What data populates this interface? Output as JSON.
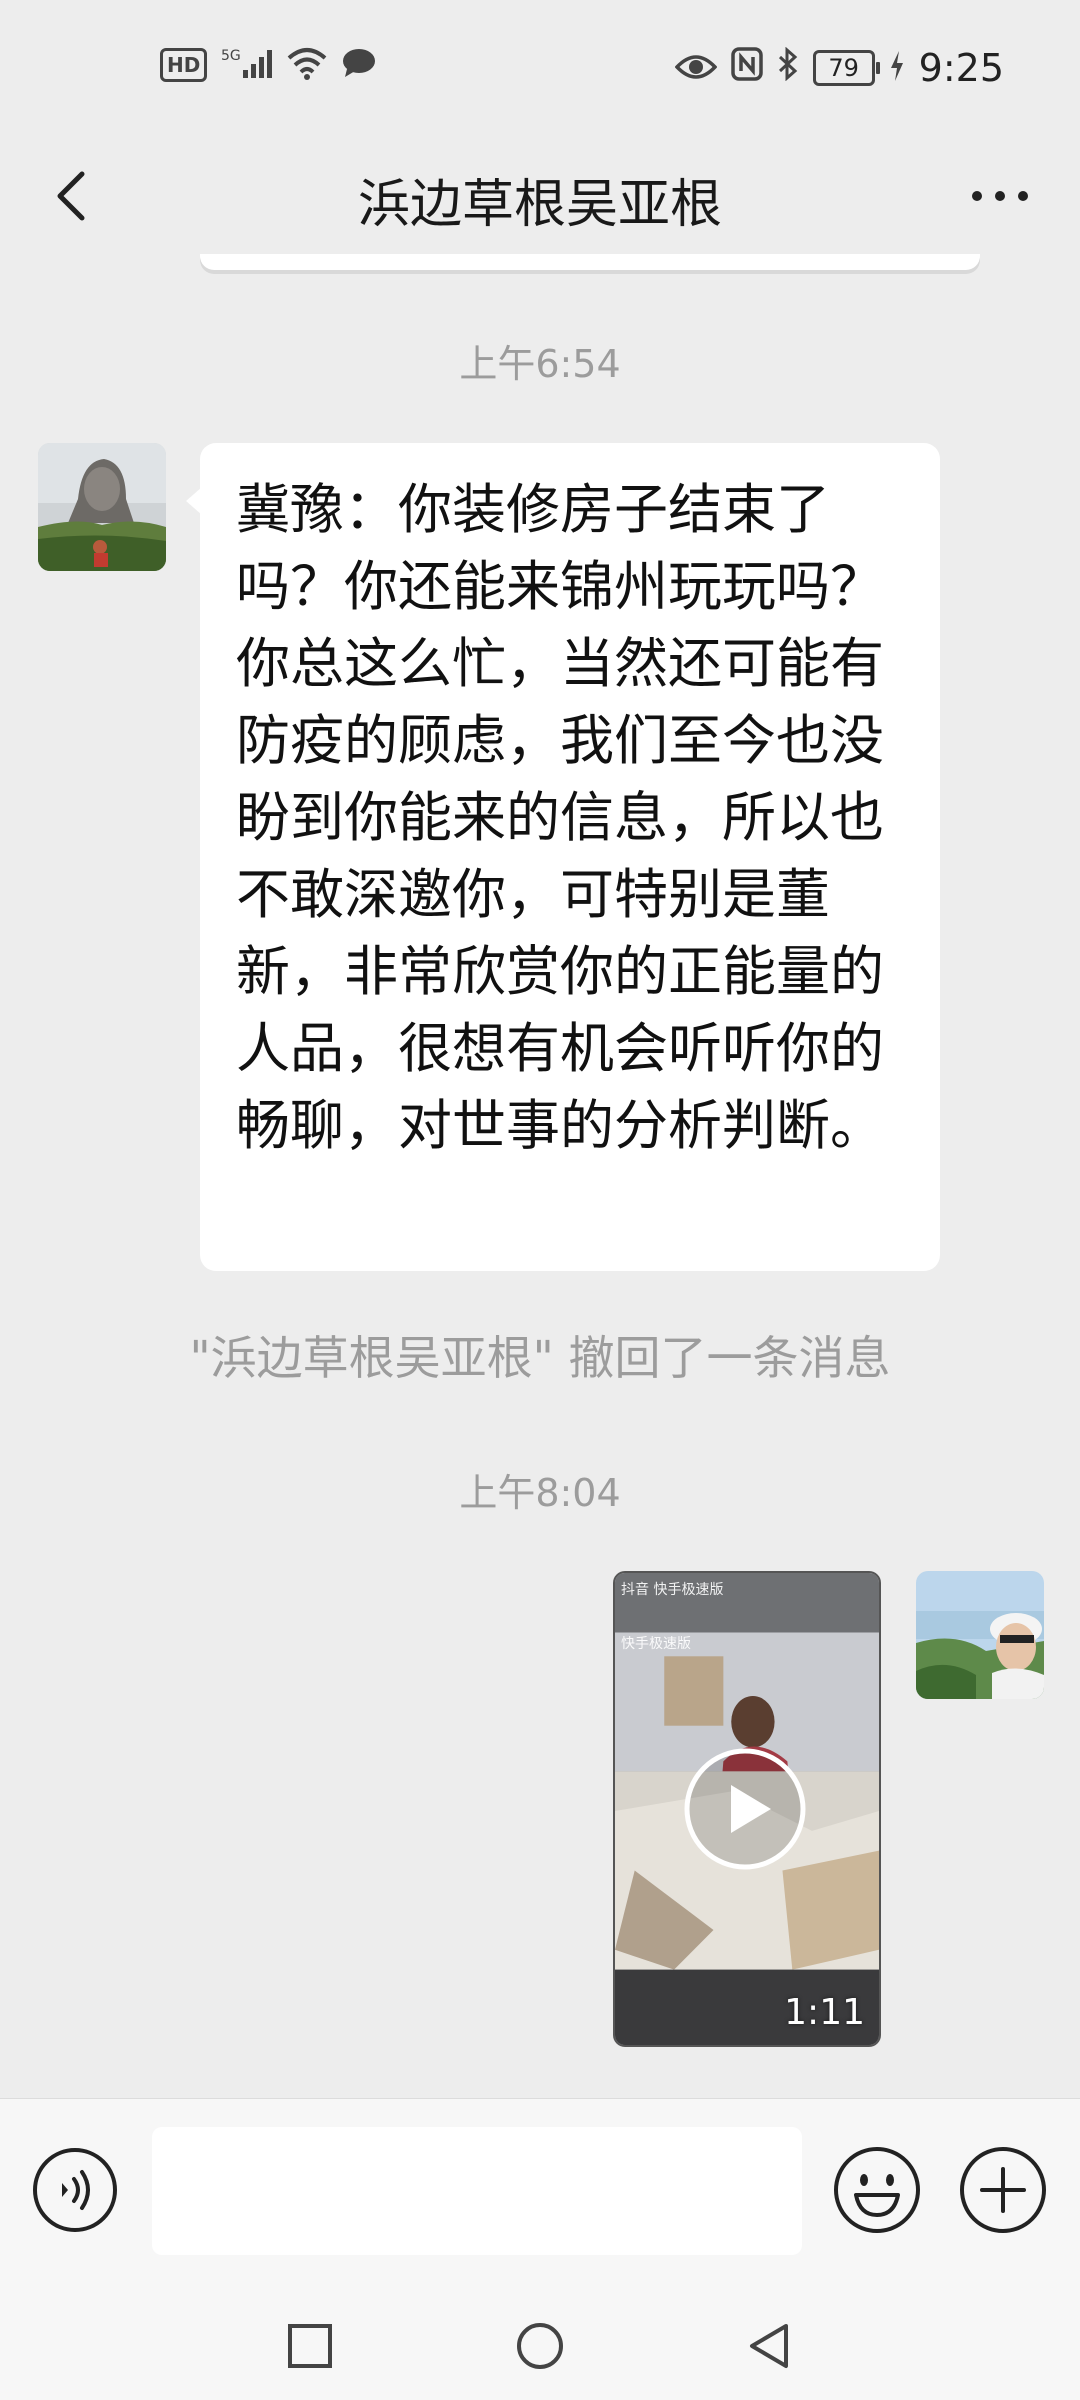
{
  "status_bar": {
    "hd_label": "HD",
    "network_label": "5G",
    "battery_level": "79",
    "time": "9:25"
  },
  "header": {
    "title": "浜边草根吴亚根",
    "back_icon": "chevron-left-icon",
    "more_icon": "more-horizontal-icon"
  },
  "messages": [
    {
      "type": "timestamp",
      "text": "上午6:54"
    },
    {
      "type": "incoming_text",
      "text": "冀豫：你装修房子结束了吗？你还能来锦州玩玩吗？你总这么忙，当然还可能有防疫的顾虑，我们至今也没盼到你能来的信息，所以也不敢深邀你，可特别是董新，非常欣赏你的正能量的人品，很想有机会听听你的畅聊，对世事的分析判断。"
    },
    {
      "type": "system",
      "text": "\"浜边草根吴亚根\" 撤回了一条消息"
    },
    {
      "type": "timestamp",
      "text": "上午8:04"
    },
    {
      "type": "outgoing_video",
      "duration": "1:11",
      "overlay_line1": "抖音 快手极速版",
      "overlay_line2": "快手极速版"
    }
  ],
  "input_bar": {
    "placeholder": "",
    "voice_icon": "voice-icon",
    "emoji_icon": "emoji-icon",
    "plus_icon": "plus-circle-icon"
  },
  "nav_bar": {
    "icons": [
      "square-icon",
      "circle-icon",
      "triangle-back-icon"
    ]
  },
  "colors": {
    "background": "#ededed",
    "bubble_incoming": "#ffffff",
    "system_text": "#9c9c9c"
  }
}
